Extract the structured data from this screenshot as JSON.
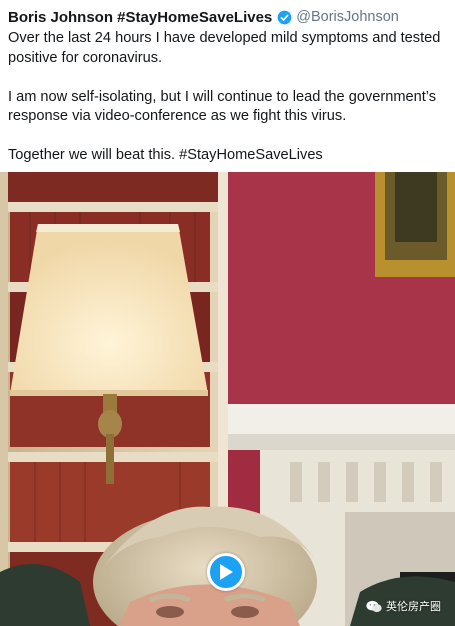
{
  "tweet": {
    "author_name": "Boris Johnson #StayHomeSaveLives",
    "verified_icon": "verified-badge-icon",
    "handle": "@BorisJohnson",
    "paragraphs": [
      "Over the last 24 hours I have developed mild symptoms and tested positive for coronavirus.",
      "I am now self-isolating, but I will continue to lead the government’s response via video-conference as we fight this virus.",
      "Together we will beat this. #StayHomeSaveLives"
    ]
  },
  "media": {
    "play_icon": "play-icon"
  },
  "watermark": {
    "icon": "wechat-icon",
    "text": "英伦房产圈"
  },
  "colors": {
    "brand_blue": "#1da1f2",
    "text": "#14171a",
    "handle": "#657786",
    "wall": "#a12b41"
  }
}
